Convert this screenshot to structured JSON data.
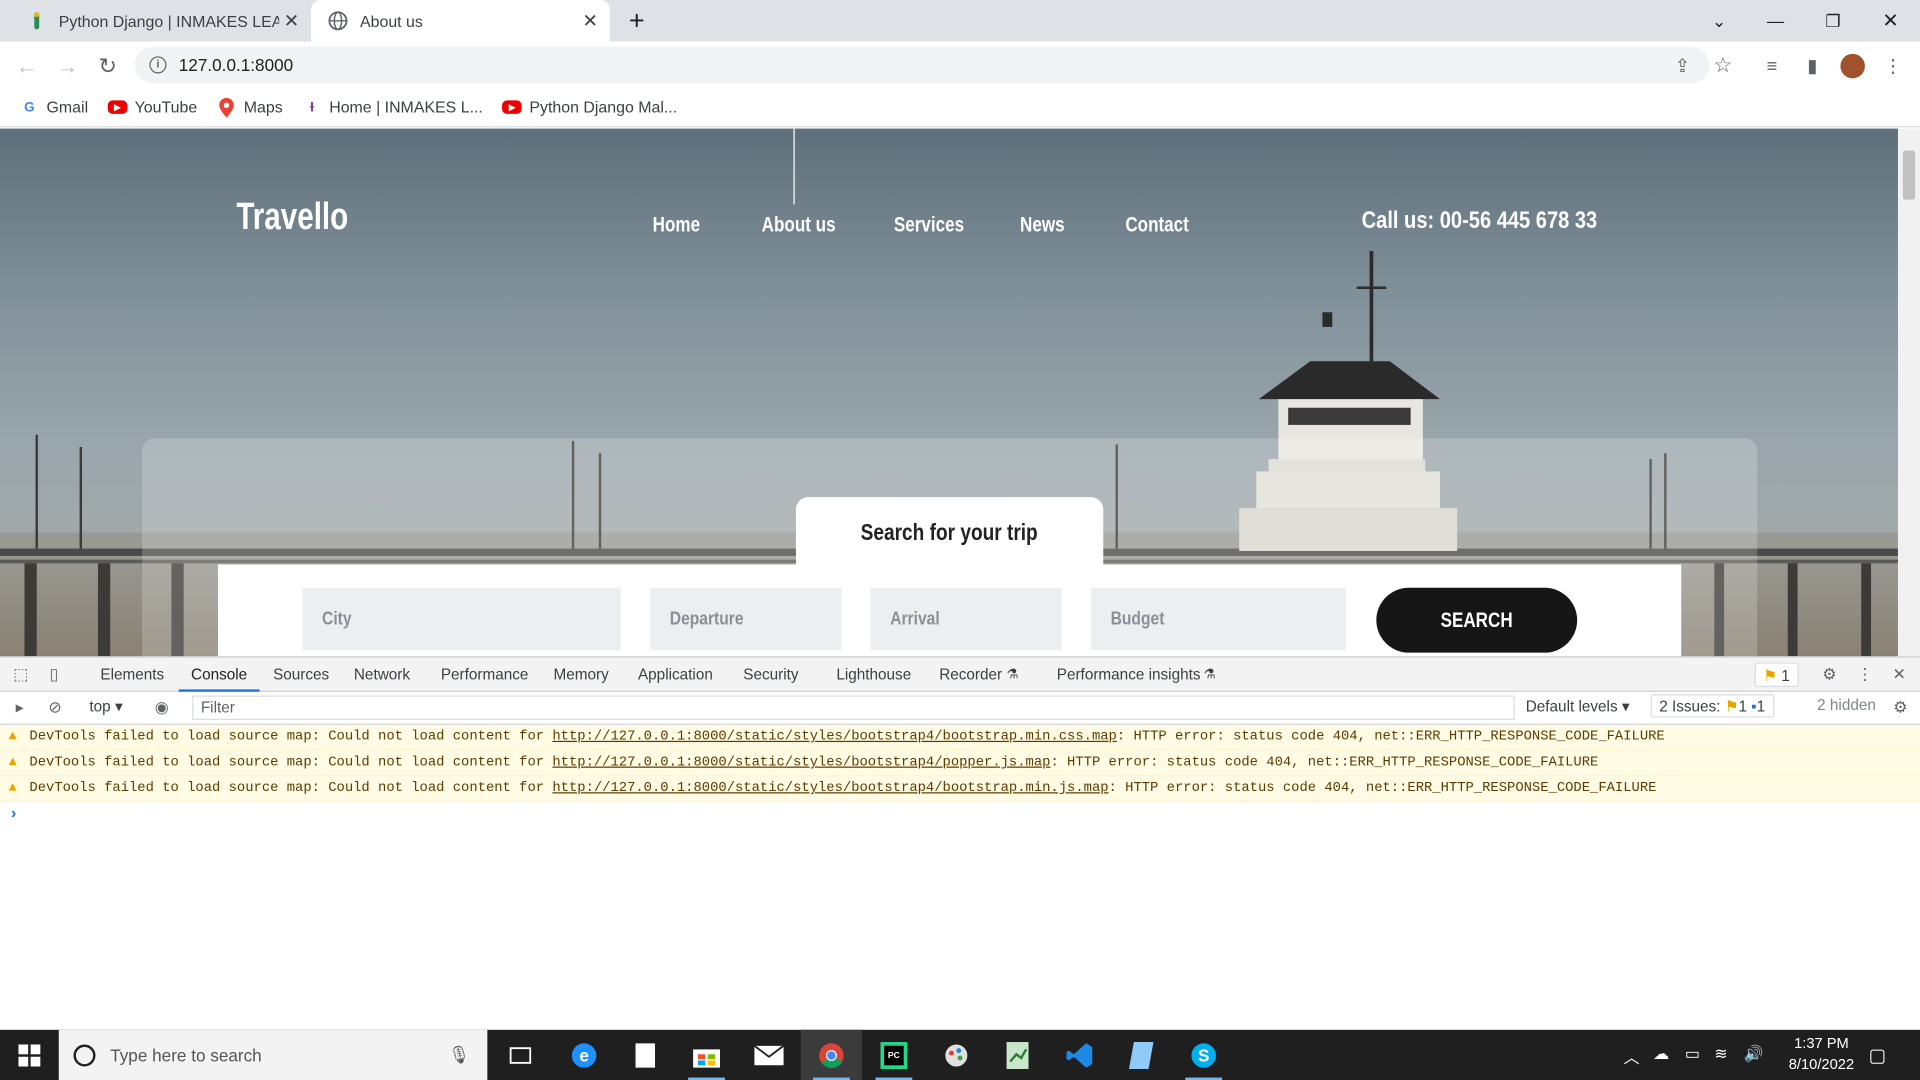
{
  "browser": {
    "tabs": [
      {
        "title": "Python Django | INMAKES LEARN",
        "icon": "inmakes-favicon-icon",
        "close": "✕"
      },
      {
        "title": "About us",
        "icon": "globe-icon",
        "close": "✕"
      }
    ],
    "new_tab": "+",
    "url": "127.0.0.1:8000",
    "bookmarks": [
      {
        "label": "Gmail",
        "icon": "google-icon"
      },
      {
        "label": "YouTube",
        "icon": "youtube-icon"
      },
      {
        "label": "Maps",
        "icon": "maps-icon"
      },
      {
        "label": "Home | INMAKES L...",
        "icon": "inmakes-icon"
      },
      {
        "label": "Python Django Mal...",
        "icon": "youtube-icon"
      }
    ]
  },
  "site": {
    "logo": "Travello",
    "nav": [
      "Home",
      "About us",
      "Services",
      "News",
      "Contact"
    ],
    "phone": "Call us: 00-56 445 678 33",
    "search_title": "Search for your trip",
    "fields": [
      "City",
      "Departure",
      "Arrival",
      "Budget"
    ],
    "search_button": "SEARCH"
  },
  "devtools": {
    "tabs": [
      "Elements",
      "Console",
      "Sources",
      "Network",
      "Performance",
      "Memory",
      "Application",
      "Security",
      "Lighthouse",
      "Recorder",
      "Performance insights"
    ],
    "active_tab": "Console",
    "issue_badge": "1",
    "context": "top",
    "filter_placeholder": "Filter",
    "levels": "Default levels",
    "issues_label": "2 Issues:",
    "issues_warn": "1",
    "issues_info": "1",
    "hidden": "2 hidden",
    "messages": [
      {
        "prefix": "DevTools failed to load source map: Could not load content for ",
        "link": "http://127.0.0.1:8000/static/styles/bootstrap4/bootstrap.min.css.map",
        "suffix": ": HTTP error: status code 404, net::ERR_HTTP_RESPONSE_CODE_FAILURE"
      },
      {
        "prefix": "DevTools failed to load source map: Could not load content for ",
        "link": "http://127.0.0.1:8000/static/styles/bootstrap4/popper.js.map",
        "suffix": ": HTTP error: status code 404, net::ERR_HTTP_RESPONSE_CODE_FAILURE"
      },
      {
        "prefix": "DevTools failed to load source map: Could not load content for ",
        "link": "http://127.0.0.1:8000/static/styles/bootstrap4/bootstrap.min.js.map",
        "suffix": ": HTTP error: status code 404, net::ERR_HTTP_RESPONSE_CODE_FAILURE"
      }
    ],
    "prompt": "›"
  },
  "taskbar": {
    "search_placeholder": "Type here to search",
    "time": "1:37 PM",
    "date": "8/10/2022"
  }
}
